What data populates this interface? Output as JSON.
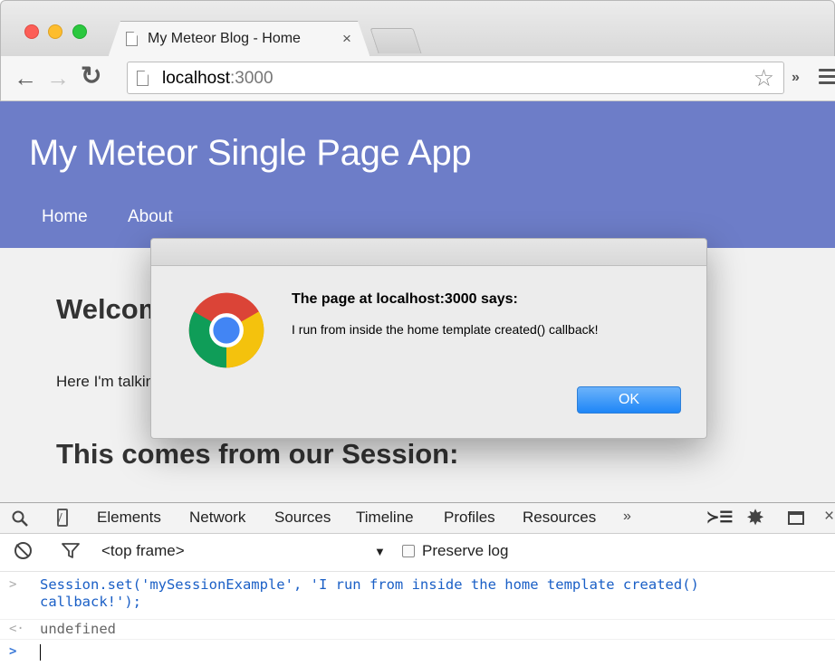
{
  "browser": {
    "tab_title": "My Meteor Blog - Home",
    "tab_close": "×",
    "url_host": "localhost",
    "url_port": ":3000",
    "star": "☆",
    "overflow_chevron": "»"
  },
  "app": {
    "title": "My Meteor Single Page App",
    "nav": [
      "Home",
      "About"
    ],
    "welcome_heading": "Welcome",
    "body_text": "Here I'm talking about my latest discoveries from the world of JavaScript.",
    "session_heading": "This comes from our Session:"
  },
  "dialog": {
    "title": "The page at localhost:3000 says:",
    "message": "I run from inside the home template created() callback!",
    "ok_label": "OK"
  },
  "devtools": {
    "tabs": [
      "Elements",
      "Network",
      "Sources",
      "Timeline",
      "Profiles",
      "Resources"
    ],
    "more": "»",
    "exec_icon": "≻☰",
    "gear": "✸",
    "close": "×",
    "frame_selector": "<top frame>",
    "dropdown_arrow": "▼",
    "preserve_log_label": "Preserve log",
    "preserve_log_checked": false,
    "console": {
      "input_prompt": ">",
      "input_line1": "Session.set('mySessionExample', 'I run from inside the home template created()",
      "input_line2": "callback!');",
      "result_prompt": "<·",
      "result": "undefined",
      "active_prompt": ">"
    }
  },
  "colors": {
    "header_bg": "#6d7dc8",
    "ok_button": "#1e86f7",
    "console_input": "#1a5fc6"
  }
}
